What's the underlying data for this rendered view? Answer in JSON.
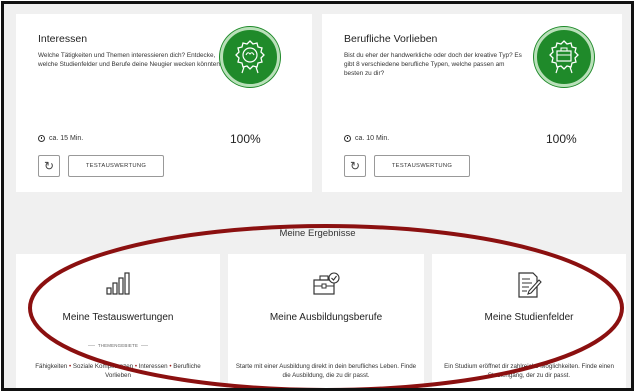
{
  "cards": [
    {
      "title": "Interessen",
      "description": "Welche Tätigkeiten und Themen interessieren dich? Entdecke, welche Studienfelder und Berufe deine Neugier wecken könnten.",
      "duration": "ca. 15 Min.",
      "percent": "100%",
      "button_label": "TESTAUSWERTUNG",
      "badge_icon": "brain-badge-icon"
    },
    {
      "title": "Berufliche Vorlieben",
      "description": "Bist du eher der handwerkliche oder doch der kreative Typ? Es gibt 8 verschiedene berufliche Typen, welche passen am besten zu dir?",
      "duration": "ca. 10 Min.",
      "percent": "100%",
      "button_label": "TESTAUSWERTUNG",
      "badge_icon": "toolbox-badge-icon"
    }
  ],
  "results": {
    "section_title": "Meine Ergebnisse",
    "items": [
      {
        "title": "Meine Testauswertungen",
        "themen_label": "THEMENGEBIETE",
        "topics": [
          "Fähigkeiten",
          "Soziale Kompetenzen",
          "Interessen",
          "Berufliche Vorlieben"
        ],
        "icon": "bar-chart-icon"
      },
      {
        "title": "Meine Ausbildungsberufe",
        "text": "Starte mit einer Ausbildung direkt in dein berufliches Leben. Finde die Ausbildung, die zu dir passt.",
        "icon": "briefcase-check-icon"
      },
      {
        "title": "Meine Studienfelder",
        "text": "Ein Studium eröffnet dir zahlreiche Möglichkeiten. Finde einen Studiengang, der zu dir passt.",
        "icon": "document-edit-icon"
      }
    ]
  },
  "colors": {
    "badge_green": "#1f8a2a",
    "oval_red": "#8b1010",
    "topic_dot": "#9a1a1a"
  }
}
